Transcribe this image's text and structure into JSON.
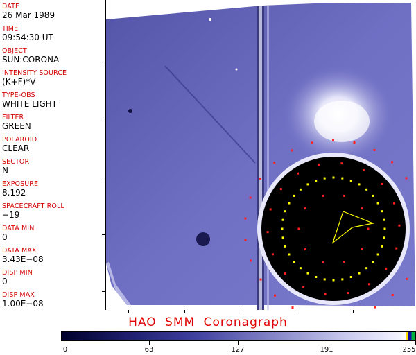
{
  "metadata": [
    {
      "label": "DATE",
      "value": "26 Mar 1989"
    },
    {
      "label": "TIME",
      "value": "09:54:30 UT"
    },
    {
      "label": "OBJECT",
      "value": "SUN:CORONA"
    },
    {
      "label": "INTENSITY SOURCE",
      "value": "(K+F)*V"
    },
    {
      "label": "TYPE-OBS",
      "value": "WHITE LIGHT"
    },
    {
      "label": "FILTER",
      "value": "GREEN"
    },
    {
      "label": "POLAROID",
      "value": "CLEAR"
    },
    {
      "label": "SECTOR",
      "value": "N"
    },
    {
      "label": "EXPOSURE",
      "value": "8.192"
    },
    {
      "label": "SPACECRAFT ROLL",
      "value": "−19"
    },
    {
      "label": "DATA MIN",
      "value": "0"
    },
    {
      "label": "DATA MAX",
      "value": "3.43E−08"
    },
    {
      "label": "DISP MIN",
      "value": "0"
    },
    {
      "label": "DISP MAX",
      "value": "1.00E−08"
    }
  ],
  "title": "HAO  SMM Coronagraph",
  "colorbar": {
    "ticks": [
      "0",
      "63",
      "127",
      "191",
      "255"
    ],
    "min": 0,
    "max": 255,
    "low_color": "#00002a",
    "high_color": "#ffffff"
  },
  "colors": {
    "label_red": "#d40000",
    "sky_blue": "#6c6cc0",
    "occulter": "#000000",
    "marker_yellow": "#ffff00",
    "marker_red": "#ff2020"
  }
}
